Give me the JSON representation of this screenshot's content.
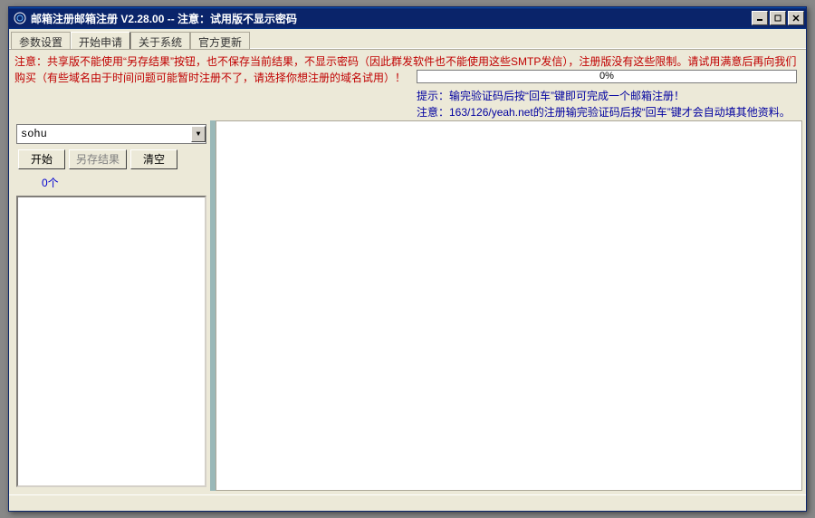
{
  "titlebar": {
    "text": "邮箱注册邮箱注册  V2.28.00  --  注意：试用版不显示密码"
  },
  "tabs": {
    "t0": "参数设置",
    "t1": "开始申请",
    "t2": "关于系统",
    "t3": "官方更新"
  },
  "warning": {
    "line": "注意：共享版不能使用“另存结果”按钮，也不保存当前结果，不显示密码（因此群发软件也不能使用这些SMTP发信），注册版没有这些限制。请试用满意后再向我们购买（有些域名由于时间问题可能暂时注册不了，请选择你想注册的域名试用）！"
  },
  "progress": {
    "pct": "0%"
  },
  "hints": {
    "h1": "提示：输完验证码后按“回车”键即可完成一个邮箱注册！",
    "h2": "注意：163/126/yeah.net的注册输完验证码后按“回车”键才会自动填其他资料。"
  },
  "left": {
    "combo": "sohu",
    "btn_start": "开始",
    "btn_save": "另存结果",
    "btn_clear": "清空",
    "count": "0个"
  }
}
